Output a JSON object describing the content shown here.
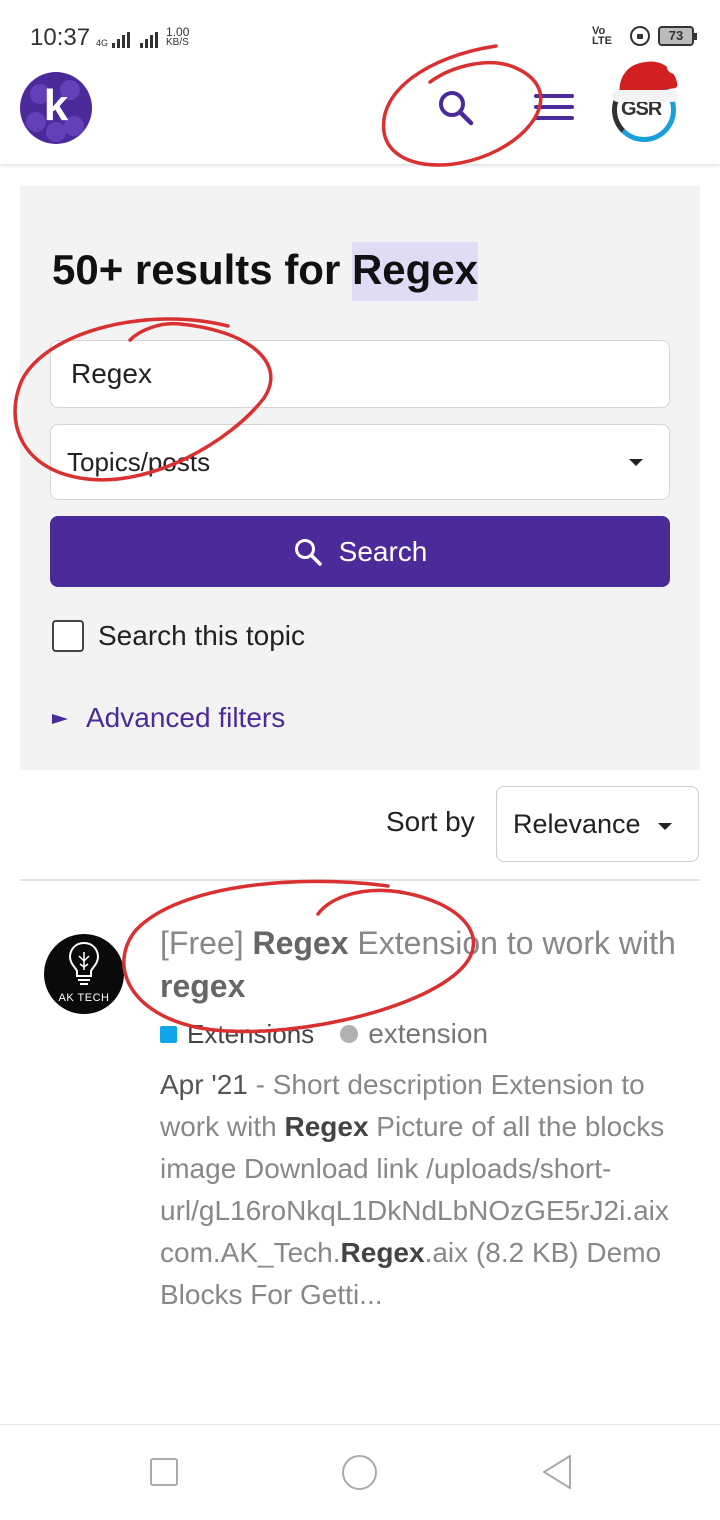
{
  "status_bar": {
    "time": "10:37",
    "network": "4G",
    "speed_value": "1.00",
    "speed_unit": "KB/S",
    "volte": "Vo LTE",
    "battery": "73"
  },
  "header": {
    "logo_letter": "k",
    "avatar_text": "GSR"
  },
  "search": {
    "heading_prefix": "50+ results for ",
    "heading_term": "Regex",
    "query": "Regex",
    "type_selected": "Topics/posts",
    "button_label": "Search",
    "checkbox_label": "Search this topic",
    "advanced_label": "Advanced filters"
  },
  "sort": {
    "label": "Sort by",
    "selected": "Relevance"
  },
  "results": [
    {
      "avatar_text": "AK TECH",
      "title_parts": [
        "[Free] ",
        "Regex",
        " Extension to work with ",
        "regex"
      ],
      "category": "Extensions",
      "tag": "extension",
      "date": "Apr '21",
      "excerpt_parts": [
        " - Short description Extension to work with ",
        "Regex",
        " Picture of all the blocks image Download link /uploads/short-url/gL16roNkqL1DkNdLbNOzGE5rJ2i.aix com.AK_Tech.",
        "Regex",
        ".aix (8.2 KB) Demo Blocks For Getti..."
      ]
    }
  ],
  "colors": {
    "brand": "#4b2a9a",
    "highlight": "#e1dcf5",
    "panel_bg": "#f3f3f3",
    "category": "#0ea5e9",
    "annotation": "#d93030"
  },
  "icons": {
    "header_search": "search-icon",
    "header_menu": "hamburger-icon",
    "button_search": "search-icon",
    "advanced_toggle": "triangle-right-icon",
    "dropdown": "caret-down-icon"
  }
}
